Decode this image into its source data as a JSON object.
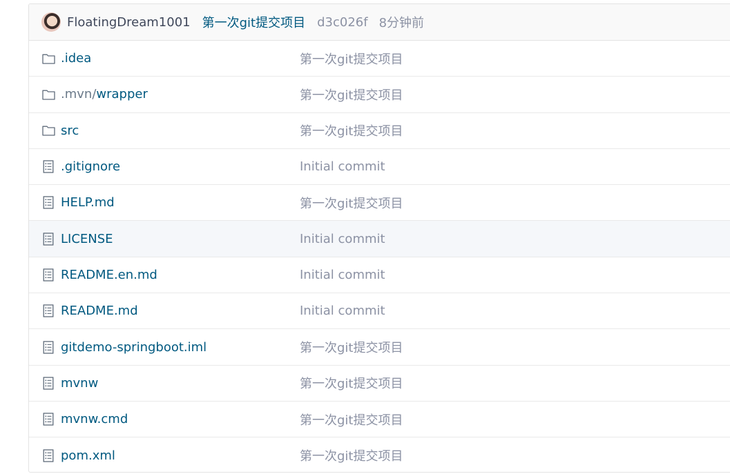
{
  "commit": {
    "author": "FloatingDream1001",
    "message": "第一次git提交项目",
    "hash": "d3c026f",
    "time": "8分钟前"
  },
  "files": [
    {
      "type": "folder",
      "name": ".idea",
      "message": "第一次git提交项目"
    },
    {
      "type": "folder",
      "name_prefix": ".mvn/",
      "name": "wrapper",
      "message": "第一次git提交项目"
    },
    {
      "type": "folder",
      "name": "src",
      "message": "第一次git提交项目"
    },
    {
      "type": "file",
      "name": ".gitignore",
      "message": "Initial commit"
    },
    {
      "type": "file",
      "name": "HELP.md",
      "message": "第一次git提交项目"
    },
    {
      "type": "file",
      "name": "LICENSE",
      "message": "Initial commit"
    },
    {
      "type": "file",
      "name": "README.en.md",
      "message": "Initial commit"
    },
    {
      "type": "file",
      "name": "README.md",
      "message": "Initial commit"
    },
    {
      "type": "file",
      "name": "gitdemo-springboot.iml",
      "message": "第一次git提交项目"
    },
    {
      "type": "file",
      "name": "mvnw",
      "message": "第一次git提交项目"
    },
    {
      "type": "file",
      "name": "mvnw.cmd",
      "message": "第一次git提交项目"
    },
    {
      "type": "file",
      "name": "pom.xml",
      "message": "第一次git提交项目"
    }
  ],
  "icons": {
    "folder": "folder-icon",
    "file": "file-icon"
  },
  "colors": {
    "link": "#005980",
    "muted": "#8c92a4",
    "hover_row": "#f5f7fa"
  }
}
